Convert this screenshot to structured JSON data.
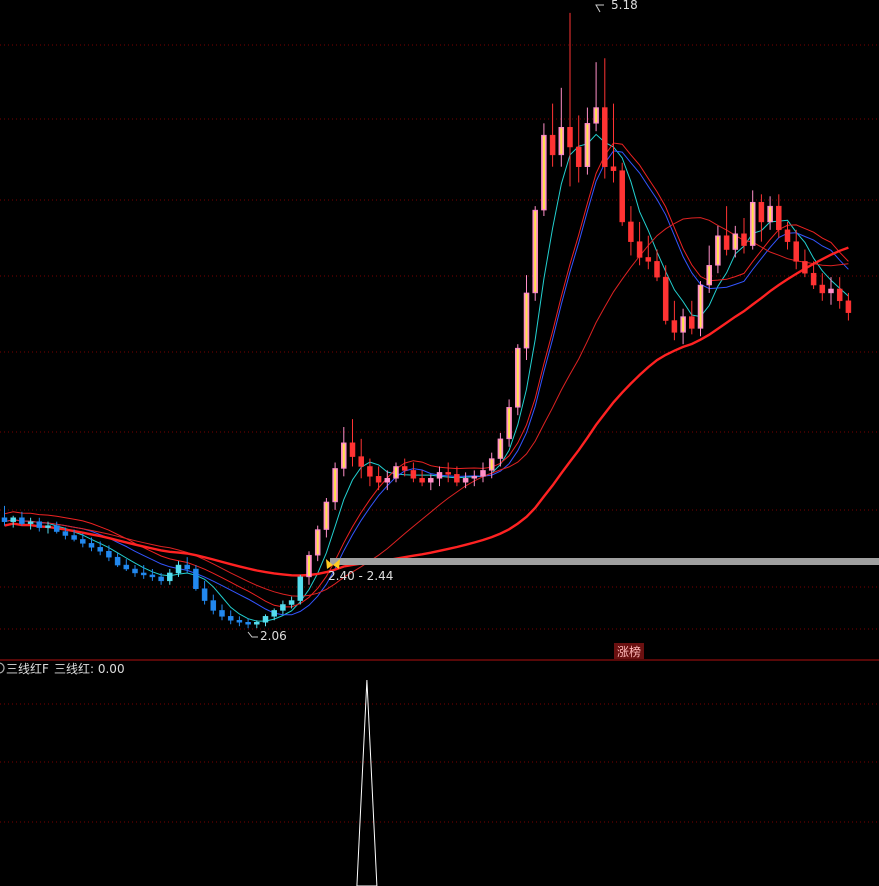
{
  "chart_data": {
    "type": "candlestick",
    "y_range_main": [
      2.0,
      5.22
    ],
    "annotations": {
      "high_label": "5.18",
      "low_label": "2.06",
      "signal_label": "2.40 - 2.44",
      "badge": "涨榜"
    },
    "indicator": {
      "title": "三线红F",
      "value_label": "三线红: 0.00",
      "signal_index": 42,
      "signal_value": 1
    },
    "candles": [
      [
        2.62,
        2.68,
        2.58,
        2.6
      ],
      [
        2.6,
        2.63,
        2.57,
        2.62
      ],
      [
        2.62,
        2.65,
        2.58,
        2.59
      ],
      [
        2.59,
        2.62,
        2.56,
        2.6
      ],
      [
        2.6,
        2.62,
        2.55,
        2.57
      ],
      [
        2.57,
        2.6,
        2.54,
        2.58
      ],
      [
        2.58,
        2.6,
        2.54,
        2.55
      ],
      [
        2.55,
        2.57,
        2.51,
        2.53
      ],
      [
        2.53,
        2.56,
        2.5,
        2.51
      ],
      [
        2.51,
        2.54,
        2.47,
        2.49
      ],
      [
        2.49,
        2.52,
        2.45,
        2.47
      ],
      [
        2.47,
        2.5,
        2.43,
        2.45
      ],
      [
        2.45,
        2.48,
        2.4,
        2.42
      ],
      [
        2.42,
        2.44,
        2.37,
        2.38
      ],
      [
        2.38,
        2.41,
        2.35,
        2.36
      ],
      [
        2.36,
        2.38,
        2.32,
        2.34
      ],
      [
        2.34,
        2.38,
        2.31,
        2.33
      ],
      [
        2.33,
        2.36,
        2.3,
        2.32
      ],
      [
        2.32,
        2.34,
        2.28,
        2.3
      ],
      [
        2.3,
        2.36,
        2.28,
        2.34
      ],
      [
        2.34,
        2.4,
        2.32,
        2.38
      ],
      [
        2.38,
        2.42,
        2.34,
        2.36
      ],
      [
        2.36,
        2.38,
        2.25,
        2.26
      ],
      [
        2.26,
        2.3,
        2.18,
        2.2
      ],
      [
        2.2,
        2.23,
        2.13,
        2.15
      ],
      [
        2.15,
        2.18,
        2.1,
        2.12
      ],
      [
        2.12,
        2.15,
        2.08,
        2.1
      ],
      [
        2.1,
        2.12,
        2.07,
        2.09
      ],
      [
        2.09,
        2.11,
        2.06,
        2.08
      ],
      [
        2.08,
        2.1,
        2.06,
        2.09
      ],
      [
        2.09,
        2.13,
        2.07,
        2.12
      ],
      [
        2.12,
        2.16,
        2.1,
        2.15
      ],
      [
        2.15,
        2.2,
        2.13,
        2.18
      ],
      [
        2.18,
        2.22,
        2.16,
        2.2
      ],
      [
        2.2,
        2.33,
        2.18,
        2.32
      ],
      [
        2.32,
        2.45,
        2.28,
        2.43
      ],
      [
        2.43,
        2.58,
        2.4,
        2.56
      ],
      [
        2.56,
        2.72,
        2.52,
        2.7
      ],
      [
        2.7,
        2.9,
        2.66,
        2.87
      ],
      [
        2.87,
        3.08,
        2.83,
        3.0
      ],
      [
        3.0,
        3.12,
        2.88,
        2.93
      ],
      [
        2.93,
        3.02,
        2.82,
        2.88
      ],
      [
        2.88,
        2.92,
        2.78,
        2.83
      ],
      [
        2.83,
        2.88,
        2.76,
        2.8
      ],
      [
        2.8,
        2.86,
        2.76,
        2.82
      ],
      [
        2.82,
        2.9,
        2.8,
        2.88
      ],
      [
        2.88,
        2.92,
        2.83,
        2.86
      ],
      [
        2.86,
        2.9,
        2.8,
        2.82
      ],
      [
        2.82,
        2.86,
        2.78,
        2.8
      ],
      [
        2.8,
        2.84,
        2.76,
        2.82
      ],
      [
        2.82,
        2.88,
        2.78,
        2.85
      ],
      [
        2.85,
        2.9,
        2.8,
        2.84
      ],
      [
        2.84,
        2.88,
        2.78,
        2.8
      ],
      [
        2.8,
        2.85,
        2.77,
        2.82
      ],
      [
        2.82,
        2.86,
        2.78,
        2.83
      ],
      [
        2.83,
        2.9,
        2.8,
        2.86
      ],
      [
        2.86,
        2.95,
        2.82,
        2.92
      ],
      [
        2.92,
        3.05,
        2.88,
        3.02
      ],
      [
        3.02,
        3.22,
        2.98,
        3.18
      ],
      [
        3.18,
        3.5,
        3.14,
        3.48
      ],
      [
        3.48,
        3.85,
        3.42,
        3.76
      ],
      [
        3.76,
        4.2,
        3.72,
        4.18
      ],
      [
        4.18,
        4.62,
        4.15,
        4.56
      ],
      [
        4.56,
        4.72,
        4.4,
        4.46
      ],
      [
        4.46,
        4.8,
        4.4,
        4.6
      ],
      [
        4.6,
        5.18,
        4.3,
        4.5
      ],
      [
        4.5,
        4.66,
        4.32,
        4.4
      ],
      [
        4.4,
        4.7,
        4.36,
        4.62
      ],
      [
        4.62,
        4.93,
        4.58,
        4.7
      ],
      [
        4.7,
        4.95,
        4.34,
        4.4
      ],
      [
        4.4,
        4.72,
        4.32,
        4.38
      ],
      [
        4.38,
        4.42,
        4.1,
        4.12
      ],
      [
        4.12,
        4.2,
        3.95,
        4.02
      ],
      [
        4.02,
        4.12,
        3.9,
        3.94
      ],
      [
        3.94,
        4.05,
        3.88,
        3.92
      ],
      [
        3.92,
        3.98,
        3.82,
        3.84
      ],
      [
        3.84,
        3.9,
        3.6,
        3.62
      ],
      [
        3.62,
        3.72,
        3.52,
        3.56
      ],
      [
        3.56,
        3.68,
        3.5,
        3.64
      ],
      [
        3.64,
        3.72,
        3.55,
        3.58
      ],
      [
        3.58,
        3.82,
        3.54,
        3.8
      ],
      [
        3.8,
        4.0,
        3.76,
        3.9
      ],
      [
        3.9,
        4.1,
        3.86,
        4.05
      ],
      [
        4.05,
        4.2,
        3.95,
        3.98
      ],
      [
        3.98,
        4.1,
        3.94,
        4.06
      ],
      [
        4.06,
        4.14,
        3.96,
        4.0
      ],
      [
        4.0,
        4.28,
        3.98,
        4.22
      ],
      [
        4.22,
        4.26,
        4.02,
        4.12
      ],
      [
        4.12,
        4.25,
        4.08,
        4.2
      ],
      [
        4.2,
        4.26,
        4.04,
        4.08
      ],
      [
        4.08,
        4.12,
        3.98,
        4.02
      ],
      [
        4.02,
        4.08,
        3.88,
        3.92
      ],
      [
        3.92,
        3.98,
        3.84,
        3.86
      ],
      [
        3.86,
        3.92,
        3.78,
        3.8
      ],
      [
        3.8,
        3.86,
        3.72,
        3.76
      ],
      [
        3.76,
        3.84,
        3.7,
        3.78
      ],
      [
        3.78,
        3.84,
        3.68,
        3.72
      ],
      [
        3.72,
        3.76,
        3.62,
        3.66
      ]
    ]
  }
}
